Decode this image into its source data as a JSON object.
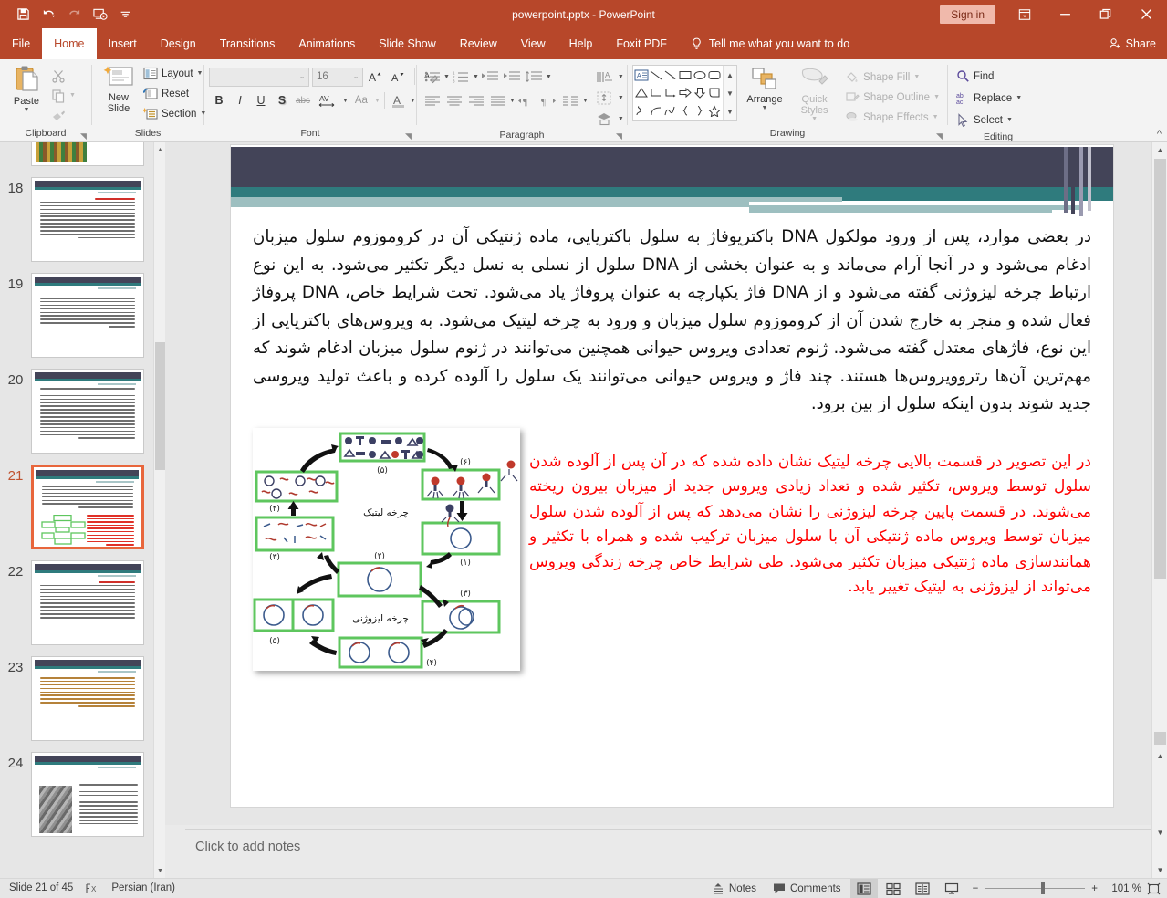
{
  "titlebar": {
    "filename": "powerpoint.pptx  -  PowerPoint",
    "signin_label": "Sign in",
    "qat": [
      {
        "name": "save-icon",
        "label": "Save"
      },
      {
        "name": "undo-icon",
        "label": "Undo"
      },
      {
        "name": "redo-icon",
        "label": "Redo"
      },
      {
        "name": "start-presentation-icon",
        "label": "Start From Beginning"
      },
      {
        "name": "customize-qat-icon",
        "label": "Customize Quick Access Toolbar"
      }
    ],
    "window_controls": [
      {
        "name": "ribbon-display-options-icon",
        "glyph": "⤒"
      },
      {
        "name": "minimize-icon",
        "glyph": "─"
      },
      {
        "name": "restore-icon",
        "glyph": "❐"
      },
      {
        "name": "close-icon",
        "glyph": "✕"
      }
    ]
  },
  "tabs": {
    "items": [
      {
        "label": "File",
        "active": false
      },
      {
        "label": "Home",
        "active": true
      },
      {
        "label": "Insert",
        "active": false
      },
      {
        "label": "Design",
        "active": false
      },
      {
        "label": "Transitions",
        "active": false
      },
      {
        "label": "Animations",
        "active": false
      },
      {
        "label": "Slide Show",
        "active": false
      },
      {
        "label": "Review",
        "active": false
      },
      {
        "label": "View",
        "active": false
      },
      {
        "label": "Help",
        "active": false
      },
      {
        "label": "Foxit PDF",
        "active": false
      }
    ],
    "tellme_placeholder": "Tell me what you want to do",
    "share_label": "Share"
  },
  "ribbon": {
    "clipboard": {
      "group_label": "Clipboard",
      "paste_label": "Paste",
      "items": [
        {
          "label": "Cut",
          "icon": "scissors-icon"
        },
        {
          "label": "Copy",
          "icon": "copy-icon"
        },
        {
          "label": "Format Painter",
          "icon": "format-painter-icon"
        }
      ]
    },
    "slides": {
      "group_label": "Slides",
      "new_slide_label": "New Slide",
      "items": [
        {
          "label": "Layout",
          "icon": "layout-icon"
        },
        {
          "label": "Reset",
          "icon": "reset-icon"
        },
        {
          "label": "Section",
          "icon": "section-icon"
        }
      ]
    },
    "font": {
      "group_label": "Font",
      "font_name": "",
      "font_name_placeholder": "",
      "font_size": "16",
      "buttons": [
        {
          "label": "Increase Font Size",
          "glyph": "A"
        },
        {
          "label": "Decrease Font Size",
          "glyph": "A"
        },
        {
          "label": "Clear All Formatting",
          "glyph": "A"
        },
        {
          "label": "Bold",
          "glyph": "B"
        },
        {
          "label": "Italic",
          "glyph": "I"
        },
        {
          "label": "Underline",
          "glyph": "U"
        },
        {
          "label": "Text Shadow",
          "glyph": "S"
        },
        {
          "label": "Strikethrough",
          "glyph": "abc"
        },
        {
          "label": "Character Spacing",
          "glyph": "AV"
        },
        {
          "label": "Change Case",
          "glyph": "Aa"
        },
        {
          "label": "Font Color",
          "glyph": "A"
        }
      ]
    },
    "paragraph": {
      "group_label": "Paragraph",
      "buttons": [
        {
          "label": "Bullets",
          "icon": "bullets-icon"
        },
        {
          "label": "Numbering",
          "icon": "numbering-icon"
        },
        {
          "label": "Decrease List Level",
          "icon": "decrease-indent-icon"
        },
        {
          "label": "Increase List Level",
          "icon": "increase-indent-icon"
        },
        {
          "label": "Line Spacing",
          "icon": "line-spacing-icon"
        },
        {
          "label": "Align Left",
          "icon": "align-left-icon"
        },
        {
          "label": "Center",
          "icon": "align-center-icon"
        },
        {
          "label": "Align Right",
          "icon": "align-right-icon"
        },
        {
          "label": "Justify",
          "icon": "justify-icon"
        },
        {
          "label": "Left-to-Right Text Direction",
          "icon": "ltr-icon"
        },
        {
          "label": "Right-to-Left Text Direction",
          "icon": "rtl-icon"
        },
        {
          "label": "Columns",
          "icon": "columns-icon"
        },
        {
          "label": "Text Direction",
          "icon": "text-direction-icon"
        },
        {
          "label": "Align Text",
          "icon": "align-text-icon"
        },
        {
          "label": "Convert to SmartArt",
          "icon": "smartart-icon"
        }
      ]
    },
    "drawing": {
      "group_label": "Drawing",
      "arrange_label": "Arrange",
      "quick_styles_label": "Quick Styles",
      "items": [
        {
          "label": "Shape Fill",
          "icon": "shape-fill-icon"
        },
        {
          "label": "Shape Outline",
          "icon": "shape-outline-icon"
        },
        {
          "label": "Shape Effects",
          "icon": "shape-effects-icon"
        }
      ]
    },
    "editing": {
      "group_label": "Editing",
      "items": [
        {
          "label": "Find",
          "icon": "search-icon"
        },
        {
          "label": "Replace",
          "icon": "replace-icon"
        },
        {
          "label": "Select",
          "icon": "cursor-icon"
        }
      ]
    }
  },
  "thumbnails": [
    {
      "number": "18",
      "selected": false
    },
    {
      "number": "19",
      "selected": false
    },
    {
      "number": "20",
      "selected": false
    },
    {
      "number": "21",
      "selected": true
    },
    {
      "number": "22",
      "selected": false
    },
    {
      "number": "23",
      "selected": false
    },
    {
      "number": "24",
      "selected": false
    }
  ],
  "slide": {
    "body_paragraph": "در بعضی موارد، پس از ورود مولکول DNA باکتریوفاژ به سلول باکتریایی، ماده ژنتیکی آن در کروموزوم سلول میزبان ادغام می‌شود و در آنجا آرام می‌ماند و به عنوان بخشی از DNA سلول از نسلی به نسل دیگر تکثیر می‌شود. به این نوع ارتباط چرخه لیزوژنی گفته می‌شود و از DNA فاژ یکپارچه به عنوان پروفاژ یاد می‌شود. تحت شرایط خاص، DNA پروفاژ فعال شده و منجر به خارج شدن آن از کروموزوم سلول میزبان و ورود به چرخه لیتیک می‌شود. به ویروس‌های باکتریایی از این نوع، فاژهای معتدل گفته می‌شود. ژنوم تعدادی ویروس حیوانی همچنین می‌توانند در ژنوم سلول میزبان ادغام شوند که مهم‌ترین آن‌ها رتروویروس‌ها هستند. چند فاژ و ویروس حیوانی می‌توانند یک سلول را آلوده کرده و باعث تولید ویروسی جدید شوند بدون اینکه سلول از بین برود.",
    "red_paragraph": "در این تصویر در قسمت بالایی چرخه لیتیک نشان داده شده که در آن پس از آلوده شدن سلول توسط ویروس، تکثیر شده و تعداد زیادی ویروس جدید از میزبان بیرون ریخته می‌شوند. در قسمت پایین چرخه لیزوژنی را نشان می‌دهد که پس از آلوده شدن سلول میزبان توسط ویروس ماده ژنتیکی آن با سلول میزبان ترکیب شده و همراه با تکثیر و همانندسازی ماده ژنتیکی میزبان تکثیر می‌شود. طی شرایط خاص چرخه زندگی ویروس می‌تواند از لیزوژنی به لیتیک تغییر یابد.",
    "diagram": {
      "lytic_label": "چرخه لیتیک",
      "lysogenic_label": "چرخه لیزوژنی",
      "step_labels": [
        "(۱)",
        "(۲)",
        "(۳)",
        "(۴)",
        "(۵)",
        "(۶)"
      ]
    }
  },
  "notes": {
    "placeholder": "Click to add notes"
  },
  "status": {
    "slide_counter": "Slide 21 of 45",
    "language": "Persian (Iran)",
    "notes_label": "Notes",
    "comments_label": "Comments",
    "zoom_level": "101 %",
    "views": [
      {
        "name": "normal-view-button",
        "active": true
      },
      {
        "name": "slide-sorter-view-button",
        "active": false
      },
      {
        "name": "reading-view-button",
        "active": false
      },
      {
        "name": "slideshow-view-button",
        "active": false
      }
    ]
  },
  "colors": {
    "accent": "#b7472a",
    "banner_dark": "#434458",
    "banner_teal": "#2f7b7d",
    "banner_light_teal": "#9dbfc0",
    "red_text": "#ff0000",
    "selection": "#e8663c"
  }
}
